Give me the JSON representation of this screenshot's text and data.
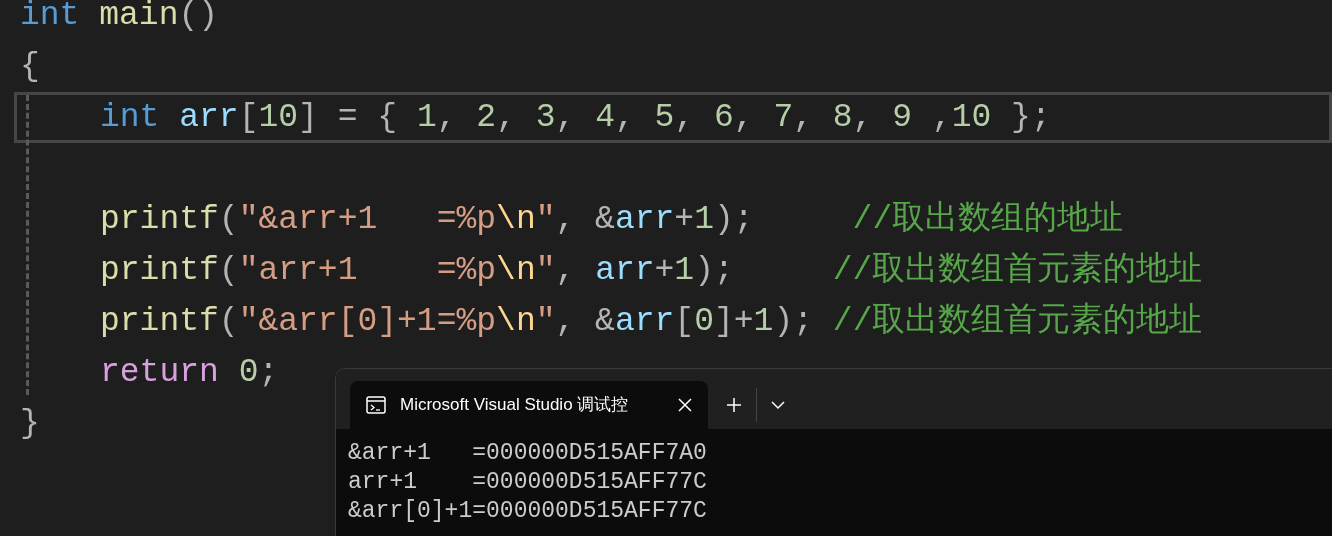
{
  "editor": {
    "lines": [
      {
        "current": false,
        "tokens": [
          {
            "kind": "keyword",
            "text": "int"
          },
          {
            "kind": "function",
            "text": " main"
          },
          {
            "kind": "punct",
            "text": "()"
          }
        ]
      },
      {
        "current": false,
        "tokens": [
          {
            "kind": "punct",
            "text": "{"
          }
        ],
        "children": [
          {
            "current": true,
            "tokens": [
              {
                "kind": "keyword",
                "text": "int"
              },
              {
                "kind": "variable",
                "text": " arr"
              },
              {
                "kind": "punct",
                "text": "["
              },
              {
                "kind": "number",
                "text": "10"
              },
              {
                "kind": "punct",
                "text": "] = { "
              },
              {
                "kind": "number",
                "text": "1"
              },
              {
                "kind": "punct",
                "text": ", "
              },
              {
                "kind": "number",
                "text": "2"
              },
              {
                "kind": "punct",
                "text": ", "
              },
              {
                "kind": "number",
                "text": "3"
              },
              {
                "kind": "punct",
                "text": ", "
              },
              {
                "kind": "number",
                "text": "4"
              },
              {
                "kind": "punct",
                "text": ", "
              },
              {
                "kind": "number",
                "text": "5"
              },
              {
                "kind": "punct",
                "text": ", "
              },
              {
                "kind": "number",
                "text": "6"
              },
              {
                "kind": "punct",
                "text": ", "
              },
              {
                "kind": "number",
                "text": "7"
              },
              {
                "kind": "punct",
                "text": ", "
              },
              {
                "kind": "number",
                "text": "8"
              },
              {
                "kind": "punct",
                "text": ", "
              },
              {
                "kind": "number",
                "text": "9"
              },
              {
                "kind": "punct",
                "text": " ,"
              },
              {
                "kind": "number",
                "text": "10"
              },
              {
                "kind": "punct",
                "text": " };"
              }
            ]
          },
          {
            "current": false
          },
          {
            "current": false,
            "tokens": [
              {
                "kind": "function",
                "text": "printf"
              },
              {
                "kind": "punct",
                "text": "("
              },
              {
                "kind": "string",
                "text": "\"&arr+1   =%p"
              },
              {
                "kind": "escape",
                "text": "\\n"
              },
              {
                "kind": "string",
                "text": "\""
              },
              {
                "kind": "punct",
                "text": ", &"
              },
              {
                "kind": "variable",
                "text": "arr"
              },
              {
                "kind": "punct",
                "text": "+"
              },
              {
                "kind": "number",
                "text": "1"
              },
              {
                "kind": "punct",
                "text": ");     "
              },
              {
                "kind": "comment",
                "text": "//取出数组的地址"
              }
            ]
          },
          {
            "current": false,
            "tokens": [
              {
                "kind": "function",
                "text": "printf"
              },
              {
                "kind": "punct",
                "text": "("
              },
              {
                "kind": "string",
                "text": "\"arr+1    =%p"
              },
              {
                "kind": "escape",
                "text": "\\n"
              },
              {
                "kind": "string",
                "text": "\""
              },
              {
                "kind": "punct",
                "text": ", "
              },
              {
                "kind": "variable",
                "text": "arr"
              },
              {
                "kind": "punct",
                "text": "+"
              },
              {
                "kind": "number",
                "text": "1"
              },
              {
                "kind": "punct",
                "text": ");     "
              },
              {
                "kind": "comment",
                "text": "//取出数组首元素的地址"
              }
            ]
          },
          {
            "current": false,
            "tokens": [
              {
                "kind": "function",
                "text": "printf"
              },
              {
                "kind": "punct",
                "text": "("
              },
              {
                "kind": "string",
                "text": "\"&arr[0]+1=%p"
              },
              {
                "kind": "escape",
                "text": "\\n"
              },
              {
                "kind": "string",
                "text": "\""
              },
              {
                "kind": "punct",
                "text": ", &"
              },
              {
                "kind": "variable",
                "text": "arr"
              },
              {
                "kind": "punct",
                "text": "["
              },
              {
                "kind": "number",
                "text": "0"
              },
              {
                "kind": "punct",
                "text": "]+"
              },
              {
                "kind": "number",
                "text": "1"
              },
              {
                "kind": "punct",
                "text": "); "
              },
              {
                "kind": "comment",
                "text": "//取出数组首元素的地址"
              }
            ]
          },
          {
            "current": false,
            "tokens": [
              {
                "kind": "control",
                "text": "return"
              },
              {
                "kind": "number",
                "text": " 0"
              },
              {
                "kind": "punct",
                "text": ";"
              }
            ]
          }
        ]
      },
      {
        "current": false,
        "tokens": [
          {
            "kind": "punct",
            "text": "}"
          }
        ]
      }
    ]
  },
  "console": {
    "tab": {
      "title": "Microsoft Visual Studio 调试控",
      "selected": true
    },
    "lines": [
      "&arr+1   =000000D515AFF7A0",
      "arr+1    =000000D515AFF77C",
      "&arr[0]+1=000000D515AFF77C"
    ]
  }
}
